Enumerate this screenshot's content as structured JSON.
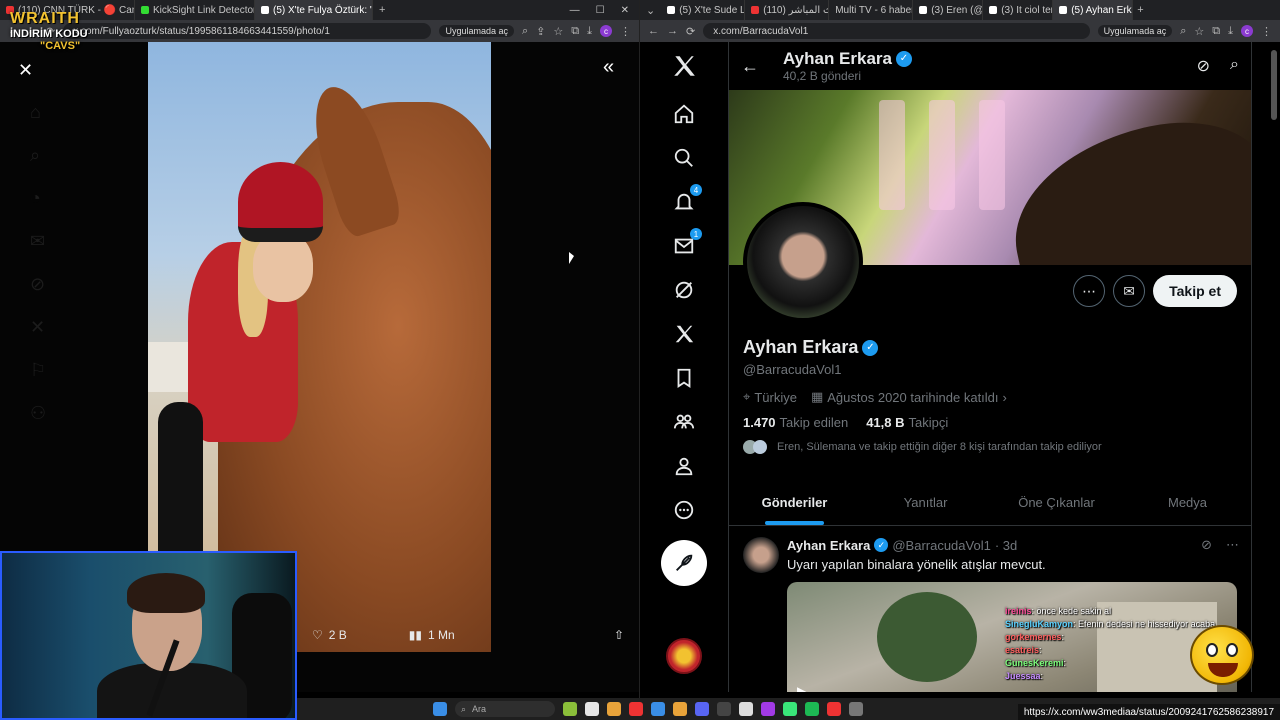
{
  "left_browser": {
    "tabs": [
      {
        "label": "(110) CNN TÜRK - 🔴 Canlı",
        "color": "#e33"
      },
      {
        "label": "KickSight Link Detector",
        "color": "#3d3"
      },
      {
        "label": "(5) X'te Fulya Öztürk: \"Türk Kızı",
        "color": "#fff",
        "active": true
      }
    ],
    "url": "x.com/Fullyaozturk/status/1995861184663441559/photo/1",
    "app_pill": "Uygulamada aç"
  },
  "overlay": {
    "brand": "WRAITH",
    "line2": "İNDİRİM KODU",
    "line3": "\"CAVS\""
  },
  "photo_actions": {
    "likes": "2 B",
    "views": "1 Mn"
  },
  "right_browser": {
    "tabs": [
      {
        "label": "(5) X'te Sude Linz"
      },
      {
        "label": "(110) البث المباشر"
      },
      {
        "label": "Multi TV - 6 haber"
      },
      {
        "label": "(3) Eren (@Ebusin"
      },
      {
        "label": "(3) It ciol temmuz"
      },
      {
        "label": "(5) Ayhan Erkara",
        "active": true
      }
    ],
    "url": "x.com/BarracudaVol1",
    "app_pill": "Uygulamada aç"
  },
  "sidebar": {
    "notif_badge": "4",
    "msg_badge": "1"
  },
  "profile": {
    "name": "Ayhan Erkara",
    "posts_count": "40,2 B gönderi",
    "handle": "@BarracudaVol1",
    "location": "Türkiye",
    "joined": "Ağustos 2020 tarihinde katıldı",
    "following_count": "1.470",
    "following_label": "Takip edilen",
    "followers_count": "41,8 B",
    "followers_label": "Takipçi",
    "known_followers": "Eren, Sülemana ve takip ettiğin diğer 8 kişi tarafından takip ediliyor",
    "follow_button": "Takip et"
  },
  "profile_tabs": [
    "Gönderiler",
    "Yanıtlar",
    "Öne Çıkanlar",
    "Medya"
  ],
  "tweet": {
    "name": "Ayhan Erkara",
    "handle": "@BarracudaVol1",
    "time": "· 3d",
    "text": "Uyarı yapılan binalara yönelik atışlar mevcut."
  },
  "chat": [
    {
      "user": "ireinis",
      "msg": ": önce kede sakin al",
      "cls": "u1"
    },
    {
      "user": "SinegluKamyon",
      "msg": ": Efenin dedesi ne hissediyor acaba",
      "cls": "u2"
    },
    {
      "user": "gorkemernes",
      "msg": ":",
      "cls": "u3"
    },
    {
      "user": "esatreis",
      "msg": ":",
      "cls": "u3"
    },
    {
      "user": "GunesKeremi",
      "msg": ":",
      "cls": "u4"
    },
    {
      "user": "Juessaa",
      "msg": ":",
      "cls": "u5"
    }
  ],
  "taskbar": {
    "search_placeholder": "Ara"
  },
  "status_url": "https://x.com/ww3mediaa/status/2009241762586238917"
}
